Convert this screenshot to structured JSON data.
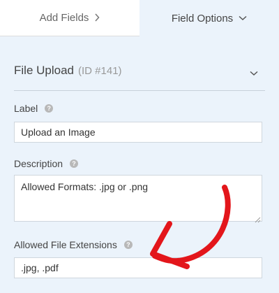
{
  "tabs": {
    "add_fields": "Add Fields",
    "field_options": "Field Options"
  },
  "field": {
    "title": "File Upload",
    "id_label": "(ID #141)"
  },
  "label_field": {
    "label": "Label",
    "value": "Upload an Image"
  },
  "description_field": {
    "label": "Description",
    "value": "Allowed Formats: .jpg or .png"
  },
  "extensions_field": {
    "label": "Allowed File Extensions",
    "value": ".jpg, .pdf"
  },
  "colors": {
    "panel_bg": "#ebf3fb",
    "annotation_arrow": "#e3161b"
  },
  "icons": [
    "chevron-right-icon",
    "chevron-down-icon",
    "help-icon",
    "resize-grip-icon",
    "annotation-arrow"
  ]
}
